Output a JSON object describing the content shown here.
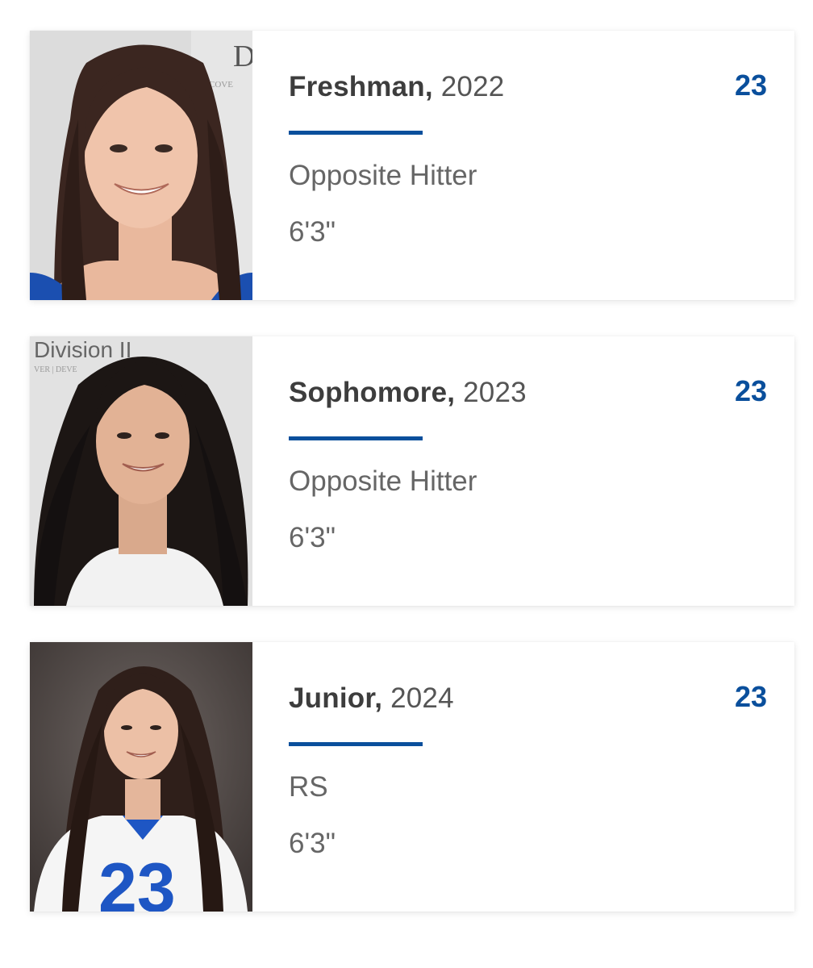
{
  "players": [
    {
      "class_label": "Freshman,",
      "year": "2022",
      "position": "Opposite Hitter",
      "height": "6'3\"",
      "number": "23",
      "backdrop_text": "D",
      "backdrop_subtext": "COVE"
    },
    {
      "class_label": "Sophomore,",
      "year": "2023",
      "position": "Opposite Hitter",
      "height": "6'3\"",
      "number": "23",
      "backdrop_text": "Division II",
      "backdrop_subtext": "VER | DEVE"
    },
    {
      "class_label": "Junior,",
      "year": "2024",
      "position": "RS",
      "height": "6'3\"",
      "number": "23",
      "jersey_number": "23"
    }
  ],
  "colors": {
    "accent": "#0a4f9c",
    "heading": "#3d3d3d",
    "muted": "#666666"
  }
}
